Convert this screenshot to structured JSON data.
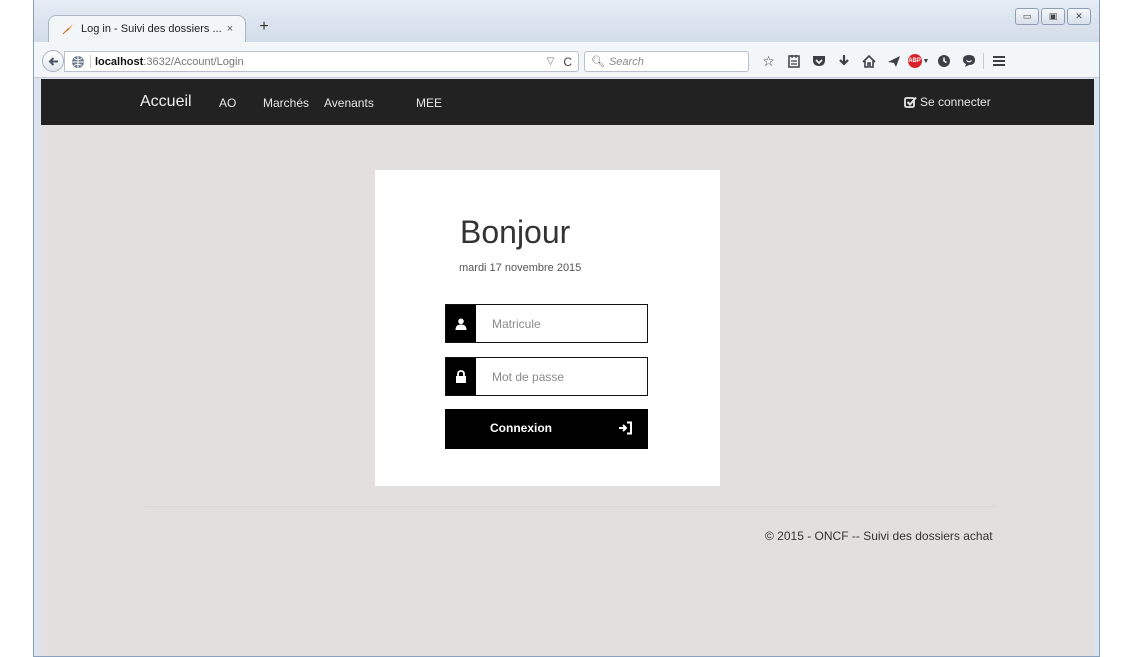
{
  "browser": {
    "tab_title": "Log in - Suivi des dossiers ...",
    "tab_close": "×",
    "new_tab": "+",
    "url_host": "localhost",
    "url_path": ":3632/Account/Login",
    "search_placeholder": "Search",
    "window_controls": [
      "▭",
      "▣",
      "✕"
    ],
    "toolbar_icons": [
      "bookmark-star-icon",
      "reading-list-icon",
      "pocket-icon",
      "downloads-icon",
      "home-icon",
      "share-icon",
      "adblock-plus-icon",
      "history-icon",
      "chat-icon",
      "menu-icon"
    ],
    "abp_label": "ABP"
  },
  "navbar": {
    "brand": "Accueil",
    "items": [
      "AO",
      "Marchés",
      "Avenants",
      "MEE"
    ],
    "login_label": "Se connecter"
  },
  "login": {
    "greeting": "Bonjour",
    "date": "mardi 17 novembre 2015",
    "matricule_placeholder": "Matricule",
    "password_placeholder": "Mot de passe",
    "submit_label": "Connexion"
  },
  "footer": {
    "text": "© 2015 - ONCF -- Suivi des dossiers achat"
  },
  "colors": {
    "navbar_bg": "#222222",
    "page_bg": "#e4dfdf",
    "button_bg": "#000000"
  }
}
